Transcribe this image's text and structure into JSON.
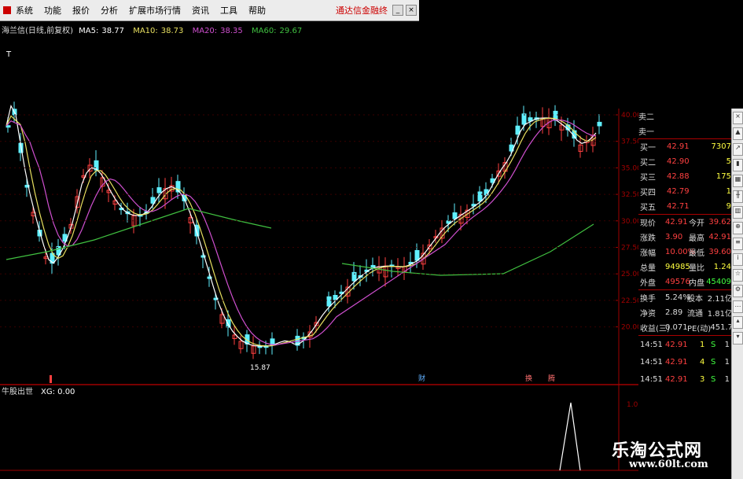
{
  "menu": {
    "items": [
      "系统",
      "功能",
      "报价",
      "分析",
      "扩展市场行情",
      "资讯",
      "工具",
      "帮助"
    ],
    "right_text": "通达信金融终"
  },
  "legend": {
    "title": "海兰信(日线,前复权)",
    "ma5_label": "MA5:",
    "ma5": "38.77",
    "ma10_label": "MA10:",
    "ma10": "38.73",
    "ma20_label": "MA20:",
    "ma20": "38.35",
    "ma60_label": "MA60:",
    "ma60": "29.67"
  },
  "colors": {
    "ma5": "#ffffff",
    "ma10": "#e8e060",
    "ma20": "#d050d0",
    "ma60": "#40c040",
    "up": "#ff4040",
    "down": "#60f0ff",
    "axis": "#a00000",
    "red_text": "#ff4040",
    "green_text": "#40ff40",
    "yellow_text": "#ffff40"
  },
  "price_axis": [
    "40.00",
    "37.50",
    "35.00",
    "32.50",
    "30.00",
    "27.50",
    "25.00",
    "22.50",
    "20.00"
  ],
  "chart_annotations": {
    "low_label": "15.87",
    "high_label": "T",
    "events": [
      "财",
      "换",
      "腾"
    ]
  },
  "indicator": {
    "title": "牛股出世",
    "value_label": "XG: 0.00",
    "axis_value": "1.00"
  },
  "order_book": {
    "sell": [
      {
        "label": "卖二",
        "price": "",
        "vol": ""
      },
      {
        "label": "卖一",
        "price": "",
        "vol": ""
      }
    ],
    "buy": [
      {
        "label": "买一",
        "price": "42.91",
        "vol": "7307"
      },
      {
        "label": "买二",
        "price": "42.90",
        "vol": "5"
      },
      {
        "label": "买三",
        "price": "42.88",
        "vol": "175"
      },
      {
        "label": "买四",
        "price": "42.79",
        "vol": "1"
      },
      {
        "label": "买五",
        "price": "42.71",
        "vol": "9"
      }
    ]
  },
  "quote": [
    {
      "l1": "现价",
      "v1": "42.91",
      "l2": "今开",
      "v2": "39.62"
    },
    {
      "l1": "涨跌",
      "v1": "3.90",
      "l2": "最高",
      "v2": "42.91"
    },
    {
      "l1": "涨幅",
      "v1": "10.00%",
      "l2": "最低",
      "v2": "39.60"
    },
    {
      "l1": "总量",
      "v1": "94985",
      "l2": "量比",
      "v2": "1.24"
    },
    {
      "l1": "外盘",
      "v1": "49576",
      "l2": "内盘",
      "v2": "45409"
    }
  ],
  "fundamentals": [
    {
      "l1": "换手",
      "v1": "5.24%",
      "l2": "股本",
      "v2": "2.11亿"
    },
    {
      "l1": "净资",
      "v1": "2.89",
      "l2": "流通",
      "v2": "1.81亿"
    },
    {
      "l1": "收益(三)",
      "v1": "0.071",
      "l2": "PE(动)",
      "v2": "451.7"
    }
  ],
  "ticks": [
    {
      "time": "14:51",
      "price": "42.91",
      "vol": "1",
      "side": "S",
      "n": "1"
    },
    {
      "time": "14:51",
      "price": "42.91",
      "vol": "4",
      "side": "S",
      "n": "1"
    },
    {
      "time": "14:51",
      "price": "42.91",
      "vol": "3",
      "side": "S",
      "n": "1"
    }
  ],
  "watermark": {
    "cn": "乐淘公式网",
    "url": "www.60lt.com"
  }
}
